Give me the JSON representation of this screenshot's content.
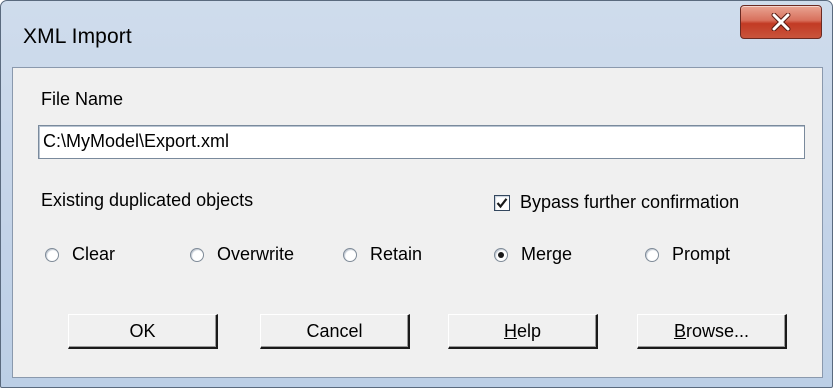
{
  "window": {
    "title": "XML Import"
  },
  "file_name": {
    "label": "File Name",
    "value": "C:\\MyModel\\Export.xml"
  },
  "duplicates": {
    "label": "Existing duplicated objects",
    "options": [
      {
        "label": "Clear",
        "checked": false
      },
      {
        "label": "Overwrite",
        "checked": false
      },
      {
        "label": "Retain",
        "checked": false
      },
      {
        "label": "Merge",
        "checked": true
      },
      {
        "label": "Prompt",
        "checked": false
      }
    ]
  },
  "bypass": {
    "label": "Bypass further confirmation",
    "checked": true
  },
  "buttons": {
    "ok": "OK",
    "cancel": "Cancel",
    "help": {
      "mnemonic": "H",
      "rest": "elp"
    },
    "browse": {
      "mnemonic": "B",
      "rest": "rowse..."
    }
  },
  "colors": {
    "close_button": "#c9543c",
    "dialog_face": "#f0f0f0",
    "frame": "#c3d3e8"
  }
}
